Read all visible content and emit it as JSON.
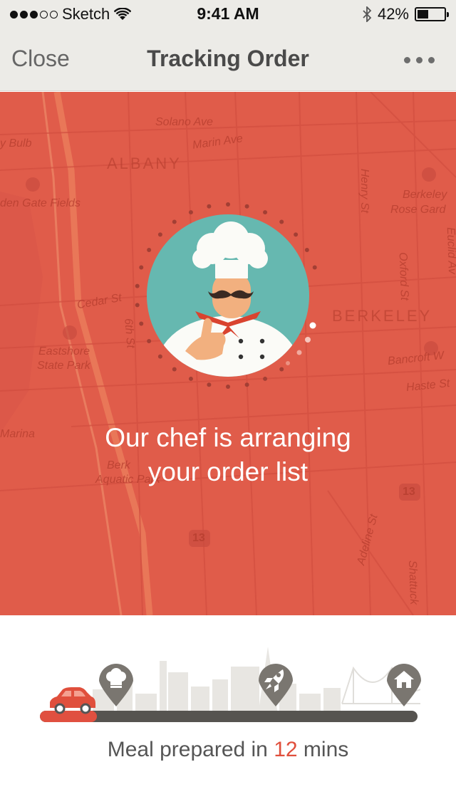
{
  "status": {
    "carrier": "Sketch",
    "signal_strength": 3,
    "time": "9:41 AM",
    "battery": "42%",
    "battery_level": 0.42
  },
  "nav": {
    "close_label": "Close",
    "title": "Tracking Order",
    "more_icon": "ellipsis-icon"
  },
  "map": {
    "labels": {
      "solano": "Solano Ave",
      "marin": "Marin Ave",
      "albany": "ALBANY",
      "bulb": "y Bulb",
      "golden_gate": "den Gate Fields",
      "berkeley_rose_1": "Berkeley",
      "berkeley_rose_2": "Rose Gard",
      "henry": "Henry St",
      "cedar": "Cedar St",
      "sixth": "6th St",
      "oxford": "Oxford St",
      "berkeley": "BERKELEY",
      "eastshore_1": "Eastshore",
      "eastshore_2": "State Park",
      "bancroft": "Bancroft W",
      "haste": "Haste St",
      "marina": "Marina",
      "aquatic_1": "Berk",
      "aquatic_2": "Aquatic Park",
      "highway_1": "13",
      "highway_2": "13",
      "adeline": "Adeline St",
      "shattuck": "Shattuck",
      "euclid": "Euclid Av"
    },
    "accent_color": "#e05c4a"
  },
  "status_message": {
    "line1": "Our chef is arranging",
    "line2": "your order list"
  },
  "progress": {
    "fraction": 0.15,
    "stages": [
      "chef-hat-icon",
      "rocket-icon",
      "home-icon"
    ],
    "eta_prefix": "Meal prepared in ",
    "eta_value": "12",
    "eta_suffix": " mins",
    "accent_color": "#e04f3c"
  }
}
